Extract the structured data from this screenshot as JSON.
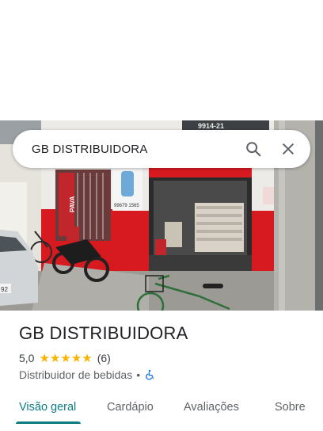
{
  "search": {
    "query": "GB DISTRIBUIDORA"
  },
  "photo": {
    "sign_phone": "9914-21",
    "poster_phone": "99679 1565",
    "plate": "92",
    "cooler_brand": "PAVA"
  },
  "place": {
    "name": "GB DISTRIBUIDORA",
    "rating": "5,0",
    "rating_value": 5.0,
    "review_count": "(6)",
    "category": "Distribuidor de bebidas",
    "separator": "•"
  },
  "tabs": [
    {
      "label": "Visão geral",
      "active": true
    },
    {
      "label": "Cardápio",
      "active": false
    },
    {
      "label": "Avaliações",
      "active": false
    },
    {
      "label": "Sobre",
      "active": false
    }
  ],
  "colors": {
    "accent": "#0b7c83",
    "star": "#f9b300",
    "storefront_red": "#d71920"
  },
  "icons": {
    "search": "search-icon",
    "close": "close-icon",
    "accessible": "wheelchair-icon"
  }
}
